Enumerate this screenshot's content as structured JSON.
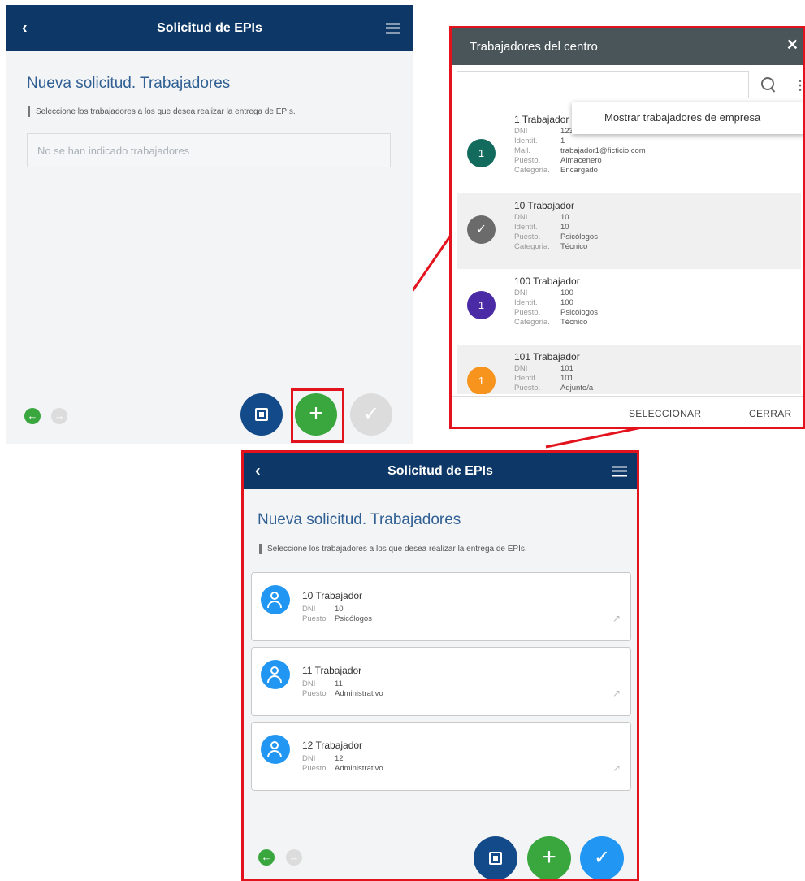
{
  "screen1": {
    "header": {
      "title": "Solicitud de EPIs",
      "back_icon": "chevron-left-icon",
      "menu_icon": "hamburger-icon"
    },
    "page_title": "Nueva solicitud. Trabajadores",
    "hint": "Seleccione los trabajadores a los que desea realizar la entrega de EPIs.",
    "empty_text": "No se han indicado trabajadores",
    "nav": {
      "prev": "←",
      "next": "→"
    },
    "actions": {
      "add": "+",
      "confirm": "✓"
    }
  },
  "dialog": {
    "title": "Trabajadores del centro",
    "close": "✕",
    "search": {
      "value": "",
      "placeholder": ""
    },
    "more_icon": "⋮",
    "popup_item": "Mostrar trabajadores de empresa",
    "workers": [
      {
        "avatar": "1",
        "color": "#136b5e",
        "name": "1 Trabajador",
        "fields": [
          {
            "k": "DNI",
            "v": "12345678Z"
          },
          {
            "k": "Identif.",
            "v": "1"
          },
          {
            "k": "Mail.",
            "v": "trabajador1@ficticio.com"
          },
          {
            "k": "Puesto.",
            "v": "Almacenero"
          },
          {
            "k": "Categoria.",
            "v": "Encargado"
          }
        ]
      },
      {
        "avatar": "✓",
        "color": "#6b6b6b",
        "name": "10 Trabajador",
        "fields": [
          {
            "k": "DNI",
            "v": "10"
          },
          {
            "k": "Identif.",
            "v": "10"
          },
          {
            "k": "Puesto.",
            "v": "Psicólogos"
          },
          {
            "k": "Categoria.",
            "v": "Técnico"
          }
        ]
      },
      {
        "avatar": "1",
        "color": "#4b2aa6",
        "name": "100 Trabajador",
        "fields": [
          {
            "k": "DNI",
            "v": "100"
          },
          {
            "k": "Identif.",
            "v": "100"
          },
          {
            "k": "Puesto.",
            "v": "Psicólogos"
          },
          {
            "k": "Categoria.",
            "v": "Técnico"
          }
        ]
      },
      {
        "avatar": "1",
        "color": "#f7941d",
        "name": "101 Trabajador",
        "fields": [
          {
            "k": "DNI",
            "v": "101"
          },
          {
            "k": "Identif.",
            "v": "101"
          },
          {
            "k": "Puesto.",
            "v": "Adjunto/a"
          }
        ]
      }
    ],
    "select_label": "SELECCIONAR",
    "close_label": "CERRAR"
  },
  "screen2": {
    "header": {
      "title": "Solicitud de EPIs"
    },
    "page_title": "Nueva solicitud. Trabajadores",
    "hint": "Seleccione los trabajadores a los que desea realizar la entrega de EPIs.",
    "cards": [
      {
        "name": "10 Trabajador",
        "dni": "10",
        "puesto": "Psicólogos"
      },
      {
        "name": "11 Trabajador",
        "dni": "11",
        "puesto": "Administrativo"
      },
      {
        "name": "12 Trabajador",
        "dni": "12",
        "puesto": "Administrativo"
      }
    ],
    "labels": {
      "dni": "DNI",
      "puesto": "Puesto"
    },
    "nav": {
      "prev": "←",
      "next": "→"
    },
    "actions": {
      "add": "+",
      "confirm": "✓"
    }
  },
  "colors": {
    "header": "#0c3766",
    "accent_blue": "#2f5f93",
    "green": "#3aa63e",
    "highlight": "#e3131d"
  }
}
